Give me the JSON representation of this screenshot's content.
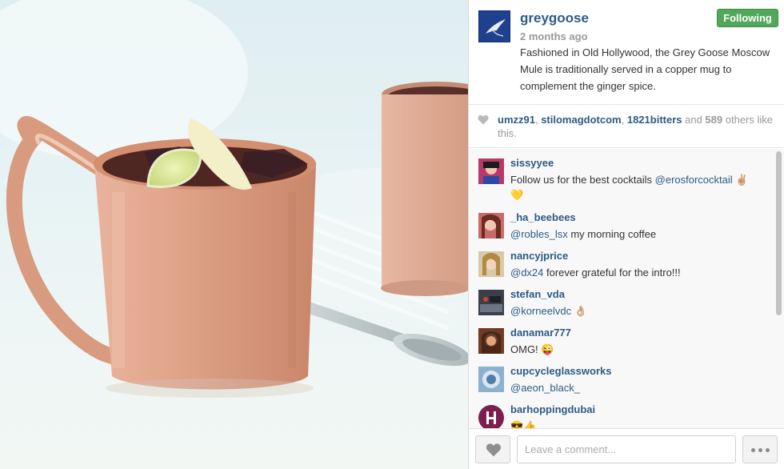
{
  "post": {
    "username": "greygoose",
    "time_ago": "2 months ago",
    "follow_label": "Following",
    "caption": "Fashioned in Old Hollywood, the Grey Goose Moscow Mule is traditionally served in a copper mug to complement the ginger spice."
  },
  "likes": {
    "users": [
      "umzz91",
      "stilomagdotcom",
      "1821bitters"
    ],
    "sep": ", ",
    "and_text": " and ",
    "others_count": "589",
    "others_text": " others like this."
  },
  "comments": [
    {
      "user": "sissyyee",
      "text_before": "Follow us for the best cocktails ",
      "mention": "@erosforcocktail",
      "text_after": " ",
      "emoji": "✌🏼 💛"
    },
    {
      "user": "_ha_beebees",
      "text_before": "",
      "mention": "@robles_lsx",
      "text_after": " my morning coffee",
      "emoji": ""
    },
    {
      "user": "nancyjprice",
      "text_before": "",
      "mention": "@dx24",
      "text_after": " forever grateful for the intro!!!",
      "emoji": ""
    },
    {
      "user": "stefan_vda",
      "text_before": "",
      "mention": "@korneelvdc",
      "text_after": " ",
      "emoji": "👌🏼"
    },
    {
      "user": "danamar777",
      "text_before": "OMG! ",
      "mention": "",
      "text_after": "",
      "emoji": "😜"
    },
    {
      "user": "cupcycleglassworks",
      "text_before": "",
      "mention": "@aeon_black_",
      "text_after": "",
      "emoji": ""
    },
    {
      "user": "barhoppingdubai",
      "text_before": "",
      "mention": "",
      "text_after": "",
      "emoji": "😎👍"
    }
  ],
  "footer": {
    "comment_placeholder": "Leave a comment..."
  },
  "icons": {
    "like": "heart-icon",
    "more": "more-dots-icon",
    "brand_logo": "grey-goose-logo"
  },
  "colors": {
    "link": "#2d5a85",
    "follow_bg": "#52a85a",
    "copper": "#d9977a"
  }
}
